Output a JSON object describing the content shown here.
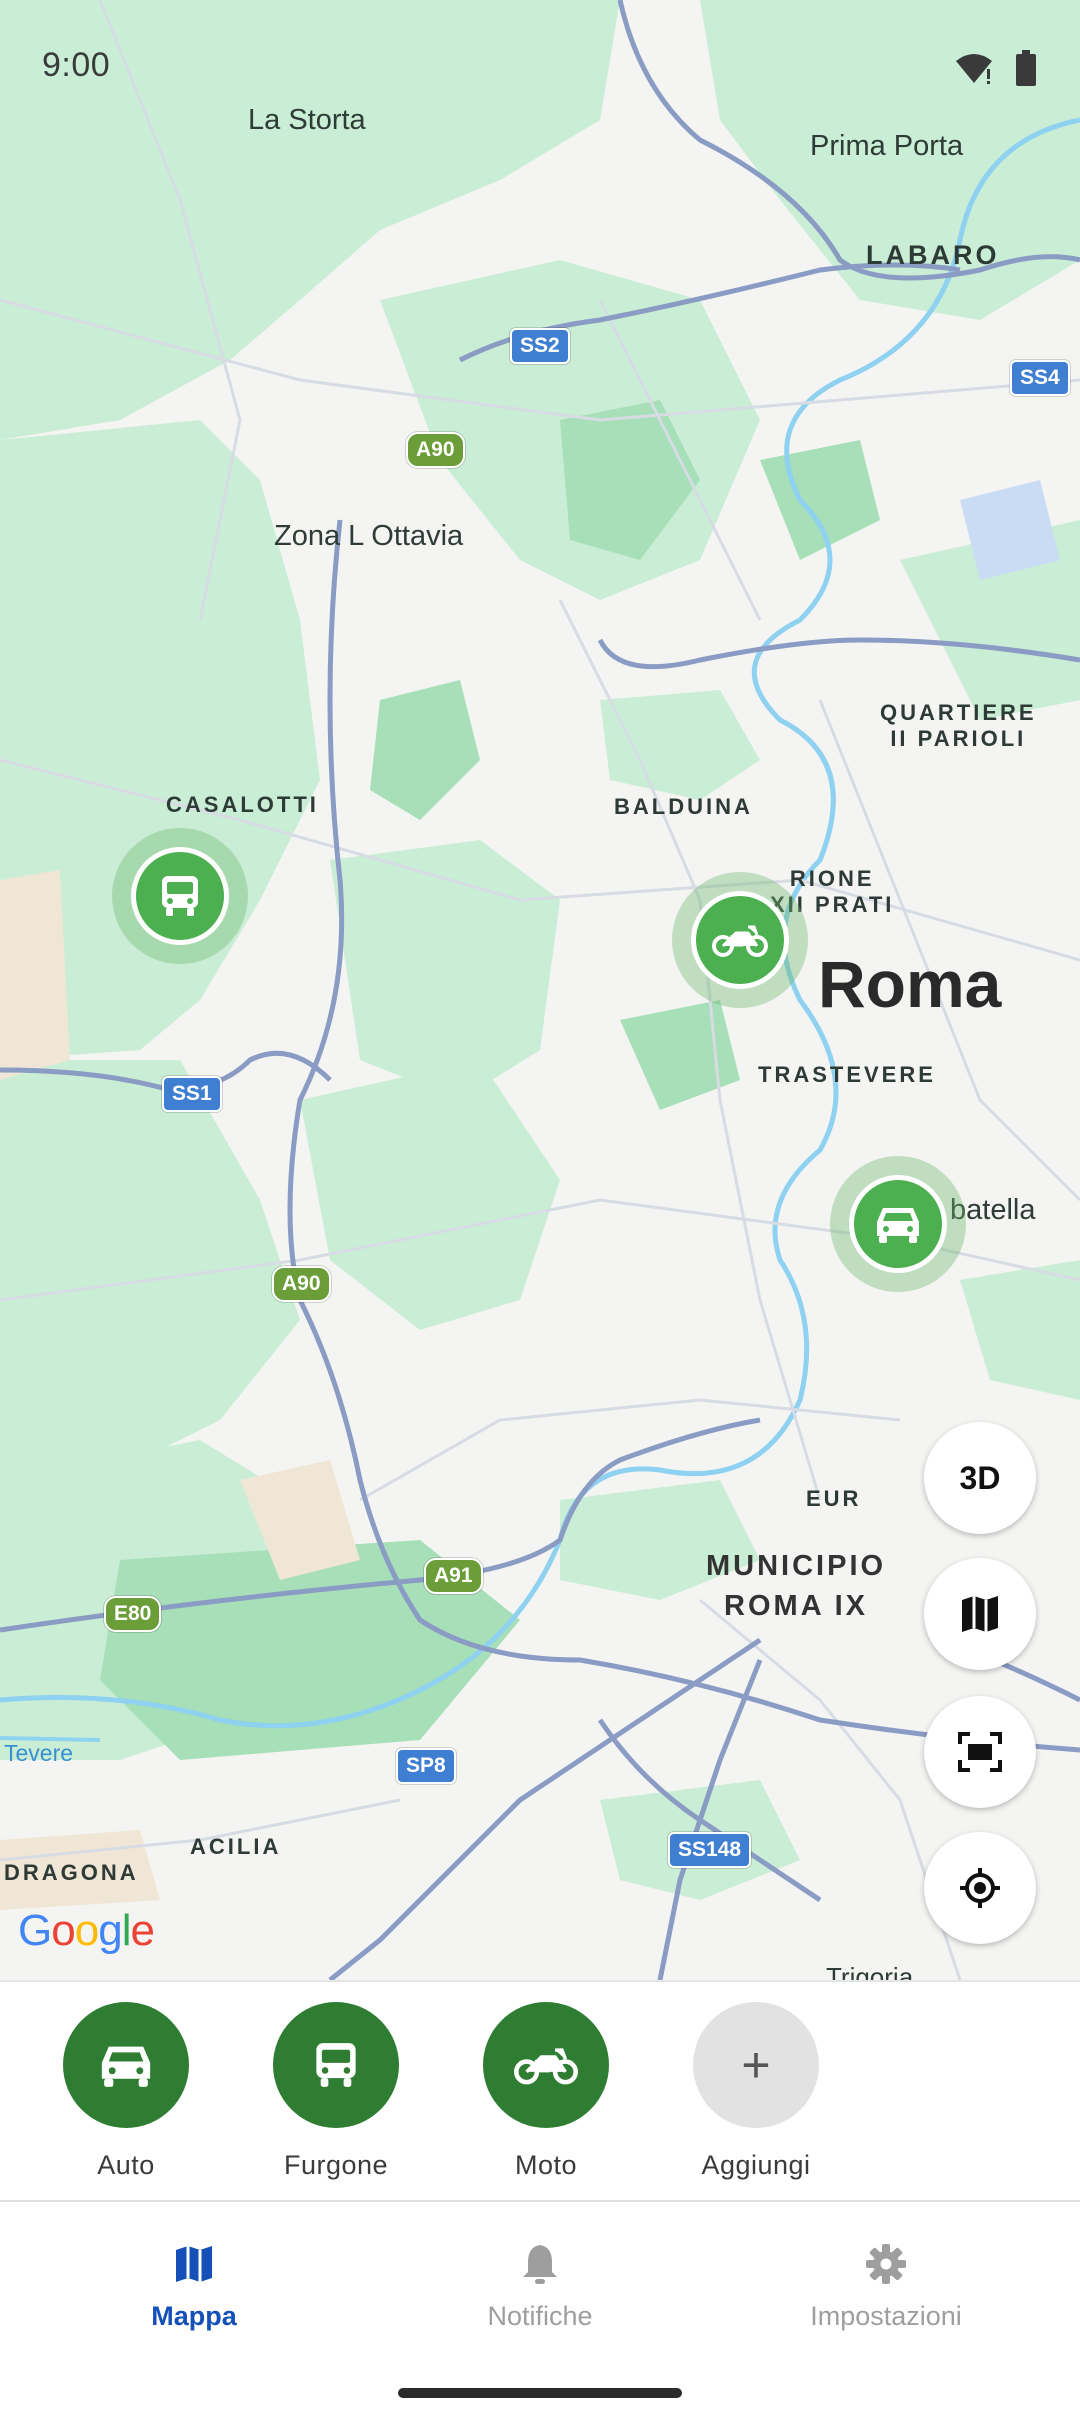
{
  "status_bar": {
    "time": "9:00"
  },
  "map": {
    "places": {
      "la_storta": "La Storta",
      "prima_porta": "Prima Porta",
      "labaro": "LABARO",
      "zona_ottavia": "Zona L Ottavia",
      "casalotti": "CASALOTTI",
      "balduina": "BALDUINA",
      "quartiere_parioli": "QUARTIERE\nII PARIOLI",
      "rione_prati": "RIONE\nXII PRATI",
      "roma": "Roma",
      "trastevere": "TRASTEVERE",
      "garbatella": "batella",
      "eur": "EUR",
      "municipio": "MUNICIPIO\nROMA IX",
      "tevere": "Tevere",
      "acilia": "ACILIA",
      "dragona": "DRAGONA",
      "trigoria": "Trigoria"
    },
    "shields": {
      "ss2": "SS2",
      "ss4": "SS4",
      "a90_top": "A90",
      "ss1": "SS1",
      "a90_bottom": "A90",
      "a91": "A91",
      "e80": "E80",
      "sp8": "SP8",
      "ss148": "SS148"
    },
    "attribution": "Google",
    "pins": [
      {
        "name": "van-marker",
        "icon": "van-icon"
      },
      {
        "name": "motorcycle-marker",
        "icon": "motorcycle-icon"
      },
      {
        "name": "car-marker",
        "icon": "car-icon"
      }
    ],
    "controls": {
      "three_d": "3D"
    },
    "colors": {
      "pin": "#4caf50",
      "park": "#c5ecd0",
      "highway": "#8a9bc4",
      "water": "#8ed1f0"
    }
  },
  "vehicles": [
    {
      "label": "Auto",
      "icon": "car-icon"
    },
    {
      "label": "Furgone",
      "icon": "van-icon"
    },
    {
      "label": "Moto",
      "icon": "motorcycle-icon"
    },
    {
      "label": "Aggiungi",
      "icon": "plus-icon",
      "symbol": "+"
    }
  ],
  "bottom_nav": {
    "items": [
      {
        "label": "Mappa",
        "icon": "map-icon",
        "active": true
      },
      {
        "label": "Notifiche",
        "icon": "bell-icon",
        "active": false
      },
      {
        "label": "Impostazioni",
        "icon": "gear-icon",
        "active": false
      }
    ],
    "active_color": "#1550b8"
  }
}
